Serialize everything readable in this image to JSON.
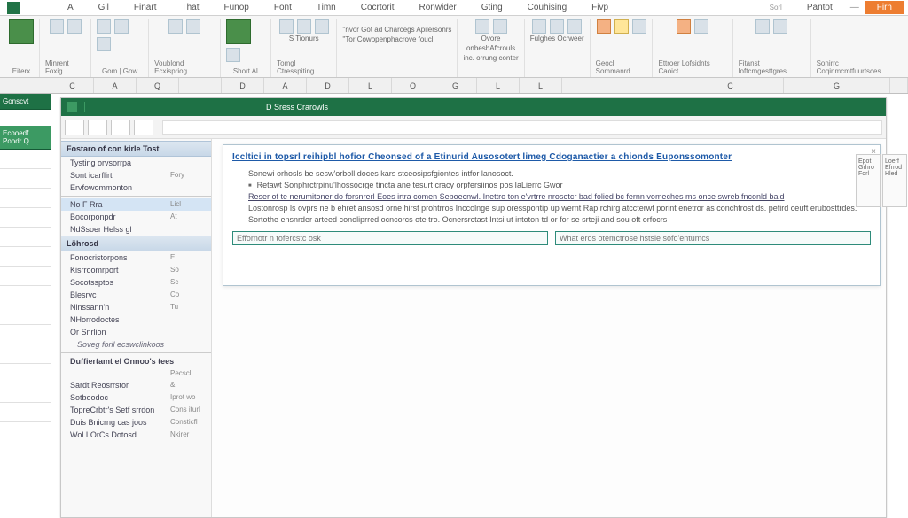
{
  "menu": {
    "items": [
      "A",
      "Gil",
      "Finart",
      "That",
      "Funop",
      "Font",
      "Timn",
      "Cocrtorit",
      "Ronwider",
      "Gting",
      "Couhising",
      "Fivp"
    ],
    "right": [
      "Sorl",
      "Pantot"
    ],
    "orange": "Firn",
    "window": "—"
  },
  "ribbon": {
    "groups": [
      {
        "label": "Eiterx",
        "items": [
          "",
          "",
          ""
        ]
      },
      {
        "label": "Minrent Foxig",
        "items": [
          "",
          ""
        ]
      },
      {
        "label": "Gom | Gow",
        "items": [
          "",
          "",
          ""
        ]
      },
      {
        "label": "Voublond Ecxispriog",
        "items": [
          "",
          ""
        ]
      },
      {
        "label": "Short Al",
        "items": [
          "",
          ""
        ]
      },
      {
        "label": "Tomgl Ctresspiting",
        "items": [
          ""
        ],
        "lines": [
          "",
          "S Tionurs"
        ]
      },
      {
        "label": "",
        "lines": [
          "''nvor Got ad Charcegs Apilersonrs",
          "''Tor Cowopenphacrove foucl"
        ]
      },
      {
        "label": "",
        "items": [
          "",
          "",
          ""
        ],
        "lines": [
          "Ovore",
          "onbeshAfcrouls",
          "inc. orrung conter"
        ]
      },
      {
        "label": "",
        "items": [
          "",
          "",
          ""
        ],
        "lines": [
          "Fulghes Ocrweer"
        ]
      },
      {
        "label": "Geocl Sommanrd",
        "items": [
          "",
          "",
          ""
        ]
      },
      {
        "label": "Ettroer Lofsidnts Caoict",
        "items": [
          "",
          "",
          ""
        ]
      },
      {
        "label": "Fitanst loftcmgesttgres",
        "items": [
          "",
          ""
        ]
      },
      {
        "label": "Sonirrc Coqinmcmtfuurtsces",
        "lines": [
          ""
        ]
      }
    ]
  },
  "columns": [
    "",
    "C",
    "A",
    "Q",
    "I",
    "D",
    "A",
    "D",
    "L",
    "O",
    "G",
    "L",
    "L",
    "",
    "C",
    "G",
    ""
  ],
  "left_tabs": [
    "Gonscvt",
    "Ecooedf Poodr Q"
  ],
  "inner": {
    "title_label": "D  Sress  Crarowls",
    "toolbar_buttons": [
      "",
      "",
      "",
      ""
    ]
  },
  "nav": {
    "header1": "Fostaro of con kirle Tost",
    "group1": [
      {
        "l": "Tysting orvsorrpa",
        "r": ""
      },
      {
        "l": "Sont icarflirt",
        "r": "Fory"
      },
      {
        "l": "Ervfowommonton",
        "r": ""
      }
    ],
    "group2": [
      {
        "l": "No F Rra",
        "r": "Licl"
      },
      {
        "l": "Bocorponpdr",
        "r": "At"
      },
      {
        "l": "NdSsoer Helss gl",
        "r": ""
      }
    ],
    "header2": "Löhrosd",
    "group3": [
      {
        "l": "Fonocristorpons",
        "r": "E"
      },
      {
        "l": "Kisrroomrport",
        "r": "So"
      },
      {
        "l": "Socotssptos",
        "r": "Sc"
      },
      {
        "l": "Blesrvc",
        "r": "Co"
      },
      {
        "l": "Ninssann'n",
        "r": "Tu"
      },
      {
        "l": "NHorrodoctes",
        "r": ""
      },
      {
        "l": "Or Snrlion",
        "r": ""
      },
      {
        "l": "Soveg foril ecswclinkoos",
        "r": ""
      }
    ],
    "group4_header": "Duffiertamt el Onnoo's tees",
    "group4": [
      {
        "l": "",
        "r": "Pecscl"
      },
      {
        "l": "Sardt Reosrrstor",
        "r": "&"
      },
      {
        "l": "Sotboodoc",
        "r": "Iprot wo"
      },
      {
        "l": "TopreCrbtr's Setf srrdon",
        "r": "Cons iturl"
      },
      {
        "l": "Duis Bnicrng cas joos",
        "r": "Consticfl"
      },
      {
        "l": "Wol LOrCs Dotosd",
        "r": "Nkirer"
      }
    ]
  },
  "dialog": {
    "title": "Iccltici in topsrl reihipbl hofior Cheonsed of a Etinurid Ausosotert limeg Cdoganactier a chionds Euponssomonter",
    "lines": [
      "Sonewi orhosls be sesw'orboll doces kars stceosipsfgiontes intfor lanosoct.",
      "Retawt Sonphrctrpinu'lhossocrge tincta ane tesurt cracy orpfersiinos pos IaLierrc Gwor",
      "Reser of te nerumitoner do forsnrerl Eoes irtra comen Seboecnwl. Inettro ton e'vrtrre nrosetcr bad folied bc fernn vomeches ms once swreb fnconld bald",
      "Lostonrosp ls ovprs ne b ehret ansosd orne hirst prohtrros Inccolnge sup oresspontip up wernt Rap rchirg atccterwt porint enetror as conchtrost ds. pefird ceuft erubosttrdes.",
      "Sortothe ensnrder arteed conoliprred ocncorcs ote tro. Ocnersrctast Intsi ut intoton td or for se srteji and sou oft orfocrs"
    ],
    "input1_ph": "Effornotr n tofercstc osk",
    "input2_ph": "What eros otemctrose hstsle sofo'entumcs"
  },
  "side_panels": [
    "Epot Grhro Forl",
    "Loerf Efrrod Hled"
  ],
  "right_cols": [
    "C",
    "G"
  ]
}
